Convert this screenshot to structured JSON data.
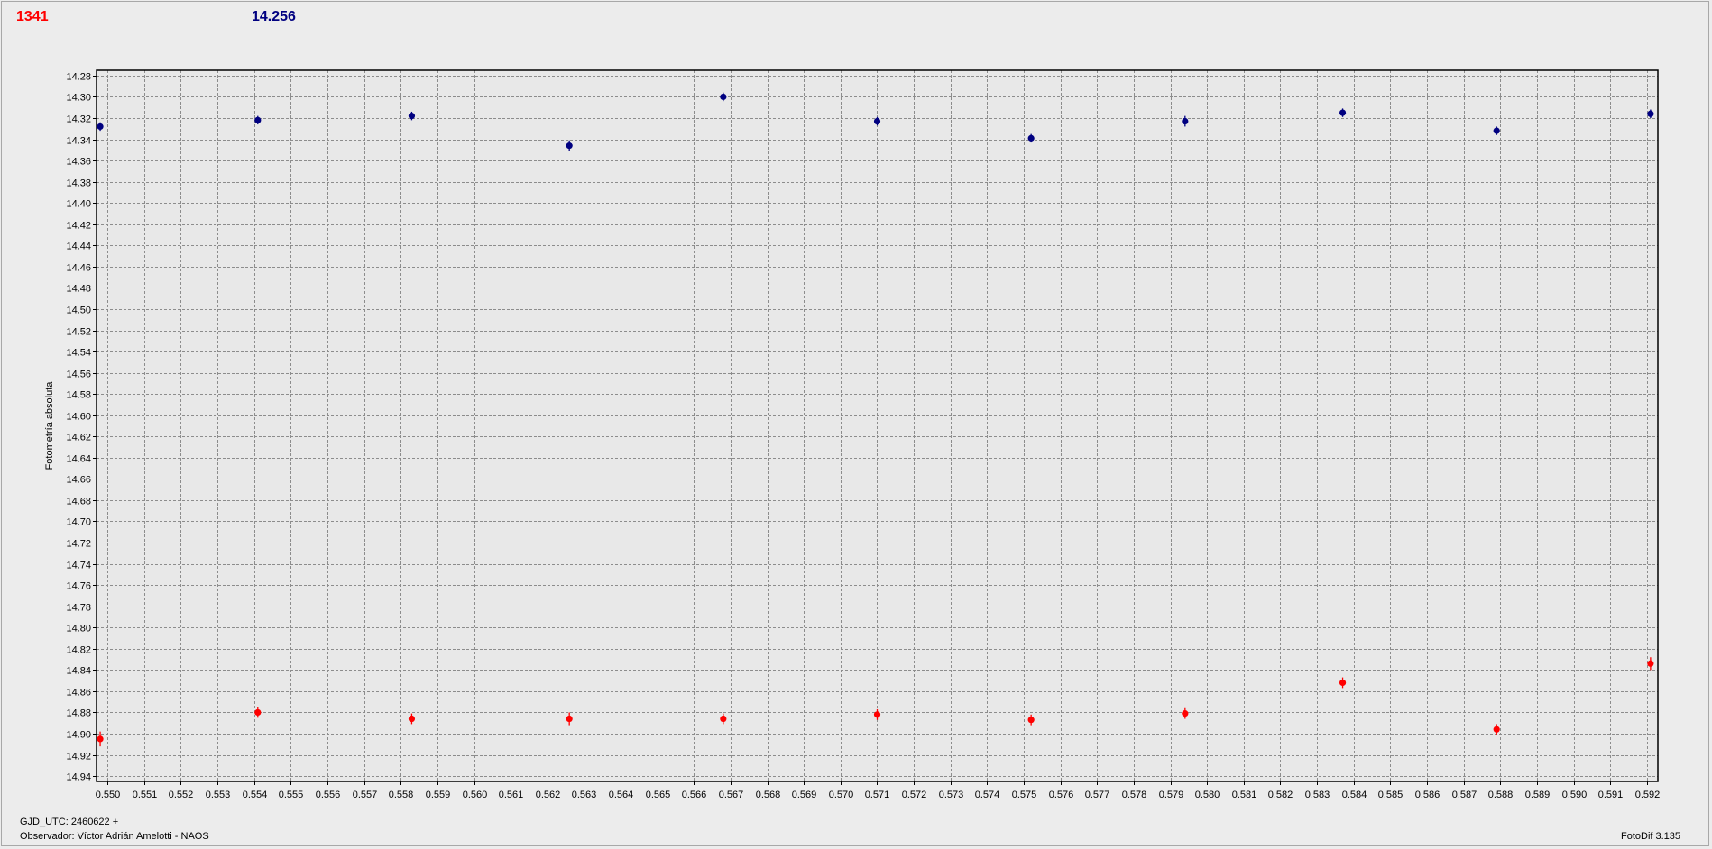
{
  "header": {
    "target_value": "1341",
    "comparison_value": "14.256"
  },
  "footer": {
    "gjd": "GJD_UTC: 2460622 +",
    "observer": "Observador: Víctor Adrián Amelotti - NAOS",
    "software": "FotoDif 3.135"
  },
  "colors": {
    "target": "#ff0000",
    "comparison": "#000080",
    "grid": "#8c8c8c"
  },
  "chart_data": {
    "type": "scatter",
    "title": "",
    "xlabel": "",
    "ylabel": "Fotometría absoluta",
    "xlim": [
      0.5497,
      0.5923
    ],
    "ylim": [
      14.275,
      14.945
    ],
    "y_inverted": true,
    "grid": true,
    "xticks": [
      "0.550",
      "0.551",
      "0.552",
      "0.553",
      "0.554",
      "0.555",
      "0.556",
      "0.557",
      "0.558",
      "0.559",
      "0.560",
      "0.561",
      "0.562",
      "0.563",
      "0.564",
      "0.565",
      "0.566",
      "0.567",
      "0.568",
      "0.569",
      "0.570",
      "0.571",
      "0.572",
      "0.573",
      "0.574",
      "0.575",
      "0.576",
      "0.577",
      "0.578",
      "0.579",
      "0.580",
      "0.581",
      "0.582",
      "0.583",
      "0.584",
      "0.585",
      "0.586",
      "0.587",
      "0.588",
      "0.589",
      "0.590",
      "0.591",
      "0.592"
    ],
    "yticks": [
      "14.28",
      "14.30",
      "14.32",
      "14.34",
      "14.36",
      "14.38",
      "14.40",
      "14.42",
      "14.44",
      "14.46",
      "14.48",
      "14.50",
      "14.52",
      "14.54",
      "14.56",
      "14.58",
      "14.60",
      "14.62",
      "14.64",
      "14.66",
      "14.68",
      "14.70",
      "14.72",
      "14.74",
      "14.76",
      "14.78",
      "14.80",
      "14.82",
      "14.84",
      "14.86",
      "14.88",
      "14.90",
      "14.92",
      "14.94"
    ],
    "series": [
      {
        "color": "#000080",
        "x": [
          0.5498,
          0.5541,
          0.5583,
          0.5626,
          0.5668,
          0.571,
          0.5752,
          0.5794,
          0.5837,
          0.5879,
          0.5921
        ],
        "y": [
          14.328,
          14.322,
          14.318,
          14.346,
          14.3,
          14.323,
          14.339,
          14.323,
          14.315,
          14.332,
          14.316
        ],
        "err": [
          0.004,
          0.004,
          0.004,
          0.005,
          0.004,
          0.004,
          0.004,
          0.005,
          0.004,
          0.004,
          0.004
        ]
      },
      {
        "color": "#ff0000",
        "x": [
          0.5498,
          0.5541,
          0.5583,
          0.5626,
          0.5668,
          0.571,
          0.5752,
          0.5794,
          0.5837,
          0.5879,
          0.5921
        ],
        "y": [
          14.905,
          14.88,
          14.886,
          14.886,
          14.886,
          14.882,
          14.887,
          14.881,
          14.852,
          14.896,
          14.834
        ],
        "err": [
          0.007,
          0.005,
          0.005,
          0.006,
          0.005,
          0.005,
          0.005,
          0.005,
          0.005,
          0.005,
          0.006
        ]
      }
    ]
  }
}
